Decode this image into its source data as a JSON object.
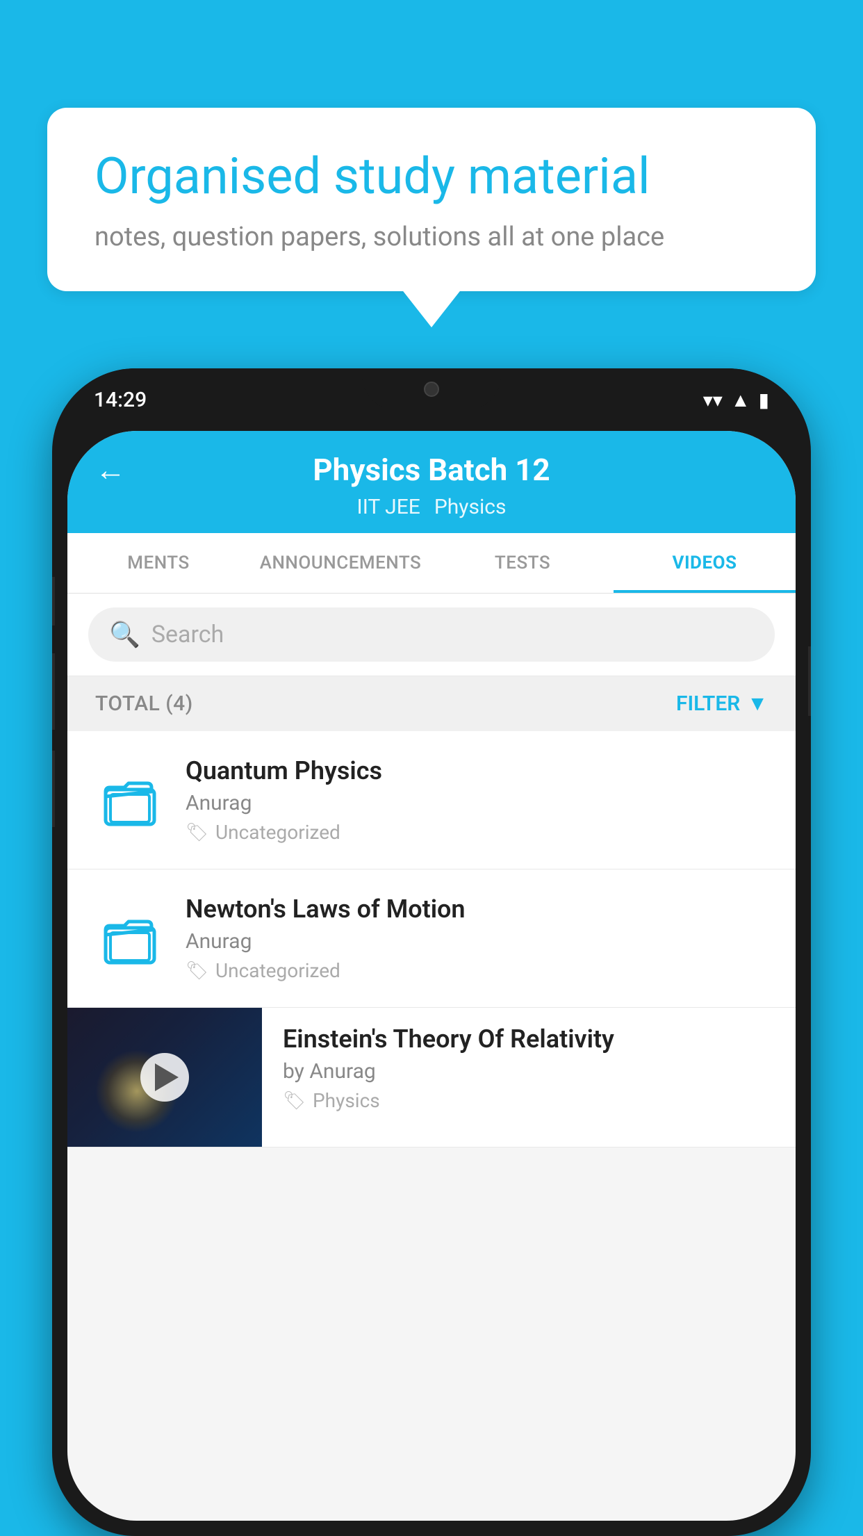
{
  "background_color": "#1ab8e8",
  "bubble": {
    "title": "Organised study material",
    "subtitle": "notes, question papers, solutions all at one place"
  },
  "phone": {
    "status_bar": {
      "time": "14:29"
    },
    "header": {
      "title": "Physics Batch 12",
      "subtitle_left": "IIT JEE",
      "subtitle_right": "Physics",
      "back_label": "←"
    },
    "tabs": [
      {
        "label": "MENTS",
        "active": false
      },
      {
        "label": "ANNOUNCEMENTS",
        "active": false
      },
      {
        "label": "TESTS",
        "active": false
      },
      {
        "label": "VIDEOS",
        "active": true
      }
    ],
    "search": {
      "placeholder": "Search"
    },
    "filter_bar": {
      "total_label": "TOTAL (4)",
      "filter_label": "FILTER"
    },
    "items": [
      {
        "title": "Quantum Physics",
        "author": "Anurag",
        "tag": "Uncategorized",
        "type": "folder"
      },
      {
        "title": "Newton's Laws of Motion",
        "author": "Anurag",
        "tag": "Uncategorized",
        "type": "folder"
      },
      {
        "title": "Einstein's Theory Of Relativity",
        "author": "by Anurag",
        "tag": "Physics",
        "type": "video"
      }
    ]
  }
}
